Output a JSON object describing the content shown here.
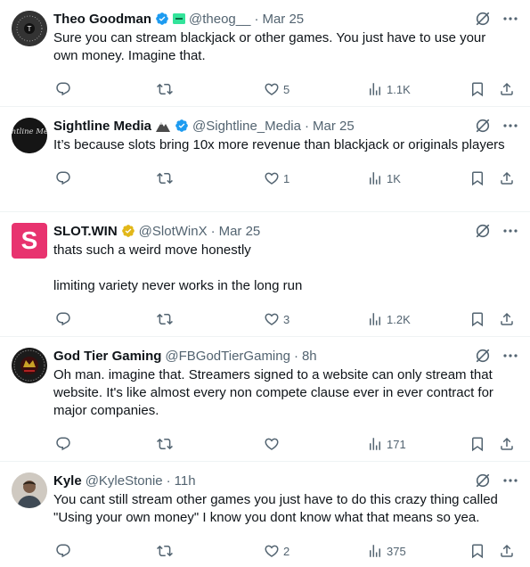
{
  "tweets": [
    {
      "name": "Theo Goodman",
      "handle": "@theog__",
      "time": "Mar 25",
      "text": "Sure you can stream blackjack or other games. You just have to use your own money. Imagine that.",
      "replies": "",
      "retweets": "",
      "likes": "5",
      "views": "1.1K",
      "verified": "blue-check",
      "avatar": "dark-circle-logo"
    },
    {
      "name": "Sightline Media",
      "handle": "@Sightline_Media",
      "time": "Mar 25",
      "text": "It’s because slots bring 10x more revenue than blackjack or originals players",
      "replies": "",
      "retweets": "",
      "likes": "1",
      "views": "1K",
      "verified": "blue-check",
      "avatar": "sightline-logo",
      "avatar_text": "Sightline Media"
    },
    {
      "name": "SLOT.WIN",
      "handle": "@SlotWinX",
      "time": "Mar 25",
      "text": "thats such a weird move honestly\n\nlimiting variety never works in the long run",
      "replies": "",
      "retweets": "",
      "likes": "3",
      "views": "1.2K",
      "verified": "gold-check",
      "avatar": "pink-s-logo",
      "avatar_text": "S"
    },
    {
      "name": "God Tier Gaming",
      "handle": "@FBGodTierGaming",
      "time": "8h",
      "text": "Oh man. imagine that. Streamers signed to a website can only stream that website. It's like almost every non compete clause ever in ever contract for major companies.",
      "replies": "",
      "retweets": "",
      "likes": "",
      "views": "171",
      "verified": "",
      "avatar": "god-tier-seal"
    },
    {
      "name": "Kyle",
      "handle": "@KyleStonie",
      "time": "11h",
      "text": "You cant still stream other games you just have to do this crazy thing called \"Using your own money\" I know you dont know what that means so yea.",
      "replies": "",
      "retweets": "",
      "likes": "2",
      "views": "375",
      "verified": "",
      "avatar": "photo"
    }
  ],
  "colors": {
    "text": "#0f1419",
    "secondary": "#536471",
    "verified_blue": "#1d9bf0",
    "verified_gold": "#e2b719",
    "slotwin_pink": "#e8336f",
    "divider": "#eff3f4"
  }
}
